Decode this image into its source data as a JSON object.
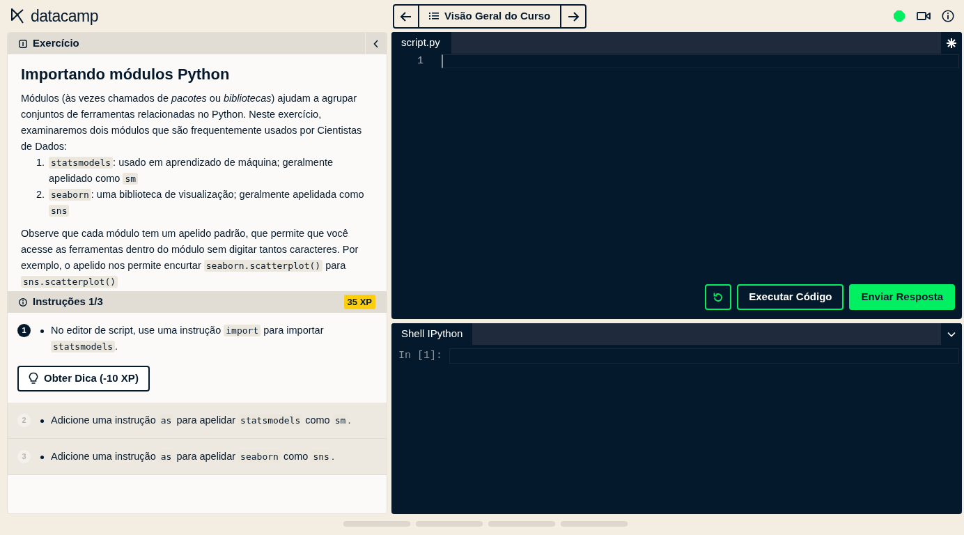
{
  "header": {
    "logo": "datacamp",
    "nav_title": "Visão Geral do Curso"
  },
  "exercise": {
    "tab_label": "Exercício",
    "title": "Importando módulos Python",
    "intro": [
      {
        "kind": "text",
        "text": "Módulos (às vezes chamados de *pacotes* ou *bibliotecas*) ajudam a agrupar conjuntos de ferramentas relacionadas no Python. Neste exercício, examinaremos dois módulos que são frequentemente usados por Cientistas de Dados:"
      }
    ],
    "list": [
      {
        "marker": "1.",
        "text": [
          {
            "kind": "code",
            "text": "statsmodels"
          },
          {
            "kind": "text",
            "text": ": usado em aprendizado de máquina; geralmente apelidado como "
          },
          {
            "kind": "code",
            "text": "sm"
          }
        ]
      },
      {
        "marker": "2.",
        "text": [
          {
            "kind": "code",
            "text": "seaborn"
          },
          {
            "kind": "text",
            "text": ": uma biblioteca de visualização; geralmente apelidada como "
          },
          {
            "kind": "code",
            "text": "sns"
          }
        ]
      }
    ],
    "note": [
      {
        "kind": "text",
        "text": "Observe que cada módulo tem um apelido padrão, que permite que você acesse as ferramentas dentro do módulo sem digitar tantos caracteres. Por exemplo, o apelido nos permite encurtar "
      },
      {
        "kind": "code",
        "text": "seaborn.scatterplot()"
      },
      {
        "kind": "text",
        "text": " para "
      },
      {
        "kind": "code",
        "text": "sns.scatterplot()"
      }
    ]
  },
  "instructions": {
    "label": "Instruções 1/3",
    "xp": "35 XP",
    "hint_button": "Obter Dica (-10 XP)",
    "steps": [
      {
        "number": "1",
        "active": true,
        "text": [
          {
            "kind": "text",
            "text": "No editor de script, use uma instrução "
          },
          {
            "kind": "code",
            "text": "import"
          },
          {
            "kind": "text",
            "text": " para importar "
          },
          {
            "kind": "code",
            "text": "statsmodels"
          },
          {
            "kind": "text",
            "text": "."
          }
        ]
      },
      {
        "number": "2",
        "active": false,
        "text": [
          {
            "kind": "text",
            "text": "Adicione uma instrução "
          },
          {
            "kind": "code",
            "text": "as"
          },
          {
            "kind": "text",
            "text": " para apelidar "
          },
          {
            "kind": "code",
            "text": "statsmodels"
          },
          {
            "kind": "text",
            "text": " como "
          },
          {
            "kind": "code",
            "text": "sm"
          },
          {
            "kind": "text",
            "text": "."
          }
        ]
      },
      {
        "number": "3",
        "active": false,
        "text": [
          {
            "kind": "text",
            "text": "Adicione uma instrução "
          },
          {
            "kind": "code",
            "text": "as"
          },
          {
            "kind": "text",
            "text": " para apelidar "
          },
          {
            "kind": "code",
            "text": "seaborn"
          },
          {
            "kind": "text",
            "text": " como "
          },
          {
            "kind": "code",
            "text": "sns"
          },
          {
            "kind": "text",
            "text": "."
          }
        ]
      }
    ]
  },
  "editor": {
    "tab": "script.py",
    "line_numbers": [
      "1"
    ],
    "run_button": "Executar Código",
    "submit_button": "Enviar Resposta"
  },
  "shell": {
    "tab": "Shell IPython",
    "prompt": "In [1]:"
  }
}
